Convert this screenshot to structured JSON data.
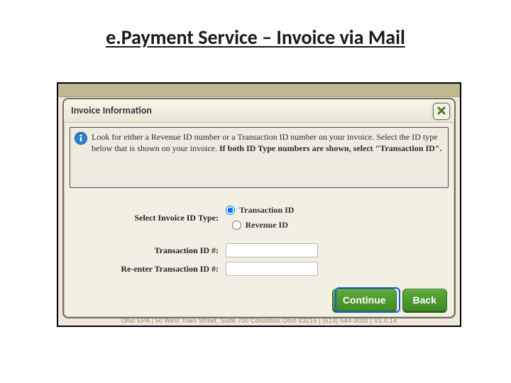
{
  "slide": {
    "title": "e.Payment Service – Invoice via Mail"
  },
  "modal": {
    "header": "Invoice Information",
    "close_label": "Close",
    "info_text_1": "Look for either a Revenue ID number or a Transaction ID number on your invoice. Select the ID type below that is shown on your invoice. ",
    "info_text_bold": "If both ID Type numbers are shown, select \"Transaction ID\"."
  },
  "form": {
    "select_label": "Select Invoice ID Type:",
    "option_transaction": "Transaction ID",
    "option_revenue": "Revenue ID",
    "selected": "transaction",
    "transaction_label": "Transaction ID #:",
    "reenter_label": "Re-enter Transaction ID #:",
    "transaction_value": "",
    "reenter_value": ""
  },
  "buttons": {
    "continue": "Continue",
    "back": "Back"
  },
  "footer": "Ohio EPA | 50 West Town Street, Suite 700 Columbus Ohio 43215 | (614) 644-3020 | V2.0.14"
}
